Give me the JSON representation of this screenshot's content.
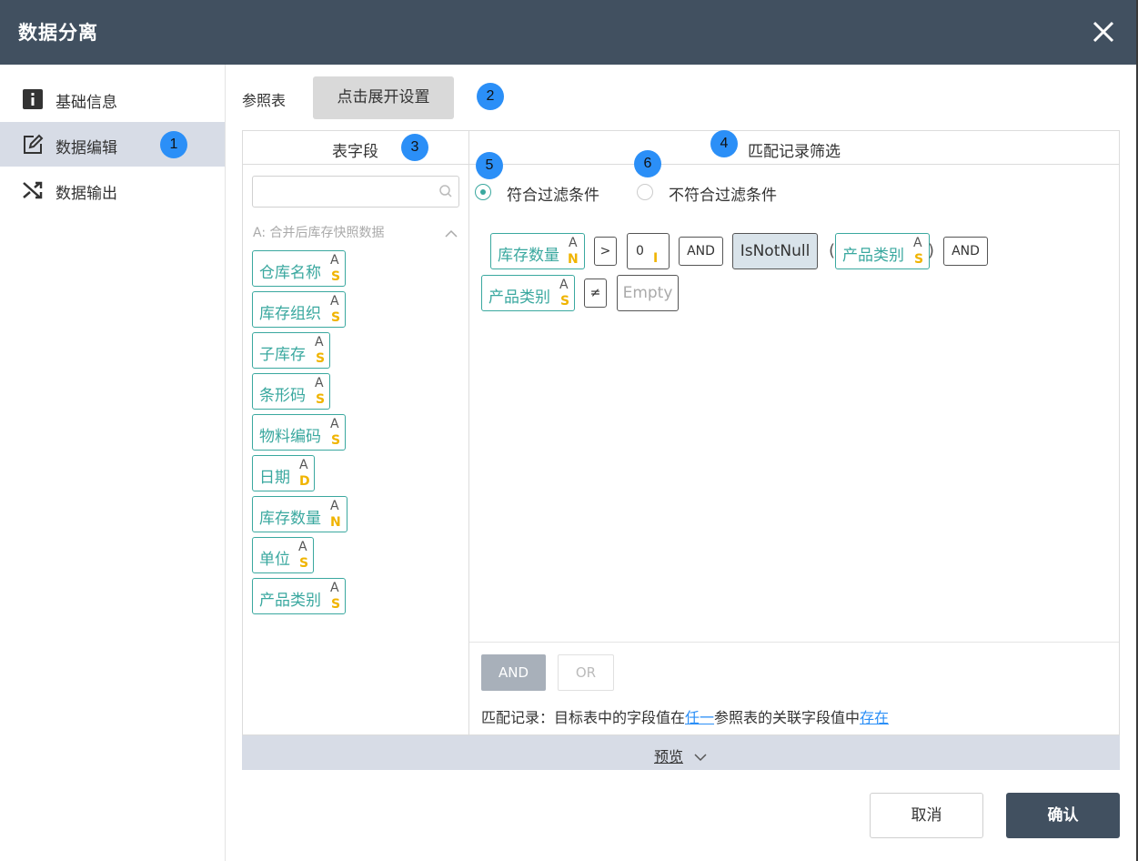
{
  "dialog": {
    "title": "数据分离"
  },
  "sidebar": {
    "items": [
      {
        "label": "基础信息",
        "icon": "info-icon",
        "active": false
      },
      {
        "label": "数据编辑",
        "icon": "edit-icon",
        "active": true,
        "badge": "1"
      },
      {
        "label": "数据输出",
        "icon": "shuffle-icon",
        "active": false
      }
    ]
  },
  "reference": {
    "label": "参照表",
    "button": "点击展开设置",
    "badge": "2"
  },
  "fields_panel": {
    "title": "表字段",
    "badge": "3",
    "search_placeholder": "",
    "group_title": "A: 合并后库存快照数据",
    "fields": [
      {
        "name": "仓库名称",
        "source": "A",
        "type": "S"
      },
      {
        "name": "库存组织",
        "source": "A",
        "type": "S"
      },
      {
        "name": "子库存",
        "source": "A",
        "type": "S"
      },
      {
        "name": "条形码",
        "source": "A",
        "type": "S"
      },
      {
        "name": "物料编码",
        "source": "A",
        "type": "S"
      },
      {
        "name": "日期",
        "source": "A",
        "type": "D"
      },
      {
        "name": "库存数量",
        "source": "A",
        "type": "N"
      },
      {
        "name": "单位",
        "source": "A",
        "type": "S"
      },
      {
        "name": "产品类别",
        "source": "A",
        "type": "S"
      }
    ]
  },
  "filter_panel": {
    "title": "匹配记录筛选",
    "badge": "4",
    "radio_match": {
      "label": "符合过滤条件",
      "selected": true,
      "badge": "5"
    },
    "radio_nomatch": {
      "label": "不符合过滤条件",
      "selected": false,
      "badge": "6"
    },
    "expr": {
      "f1": {
        "name": "库存数量",
        "source": "A",
        "type": "N"
      },
      "op1": ">",
      "val1": {
        "value": "0",
        "type": "I"
      },
      "and1": "AND",
      "func": "IsNotNull",
      "lparen": "(",
      "f2": {
        "name": "产品类别",
        "source": "A",
        "type": "S"
      },
      "rparen": ")",
      "and2": "AND",
      "f3": {
        "name": "产品类别",
        "source": "A",
        "type": "S"
      },
      "op2": "≠",
      "val2": "Empty"
    },
    "and_button": "AND",
    "or_button": "OR",
    "match_text": {
      "prefix": "匹配记录：目标表中的字段值在",
      "link1": "任一",
      "middle": "参照表的关联字段值中",
      "link2": "存在"
    }
  },
  "preview": {
    "label": "预览"
  },
  "footer": {
    "cancel": "取消",
    "confirm": "确认"
  },
  "colors": {
    "header": "#415060",
    "accent": "#3aa89f",
    "badge": "#2b8ff7",
    "type_letter": "#f0b400",
    "selected_nav": "#d7dce6"
  }
}
